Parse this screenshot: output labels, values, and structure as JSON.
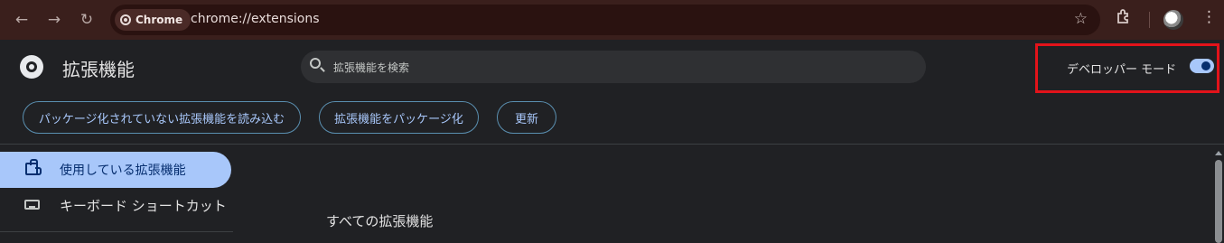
{
  "browser": {
    "chip_label": "Chrome",
    "url": "chrome://extensions",
    "icons": [
      "back-icon",
      "forward-icon",
      "reload-icon",
      "star-icon",
      "extensions-icon",
      "profile-avatar",
      "menu-icon"
    ]
  },
  "header": {
    "title": "拡張機能",
    "search_placeholder": "拡張機能を検索",
    "dev_mode_label": "デベロッパー モード",
    "dev_mode_on": true
  },
  "actions": {
    "load_unpacked": "パッケージ化されていない拡張機能を読み込む",
    "pack_extension": "拡張機能をパッケージ化",
    "update": "更新"
  },
  "sidebar": {
    "items": [
      {
        "label": "使用している拡張機能",
        "icon": "puzzle-icon",
        "active": true
      },
      {
        "label": "キーボード ショートカット",
        "icon": "keyboard-icon",
        "active": false
      }
    ]
  },
  "main": {
    "section_title": "すべての拡張機能"
  },
  "colors": {
    "accent": "#a8c7fa",
    "highlight": "#e2131a",
    "toolbar_bg": "#3a1f1c",
    "page_bg": "#202124"
  }
}
